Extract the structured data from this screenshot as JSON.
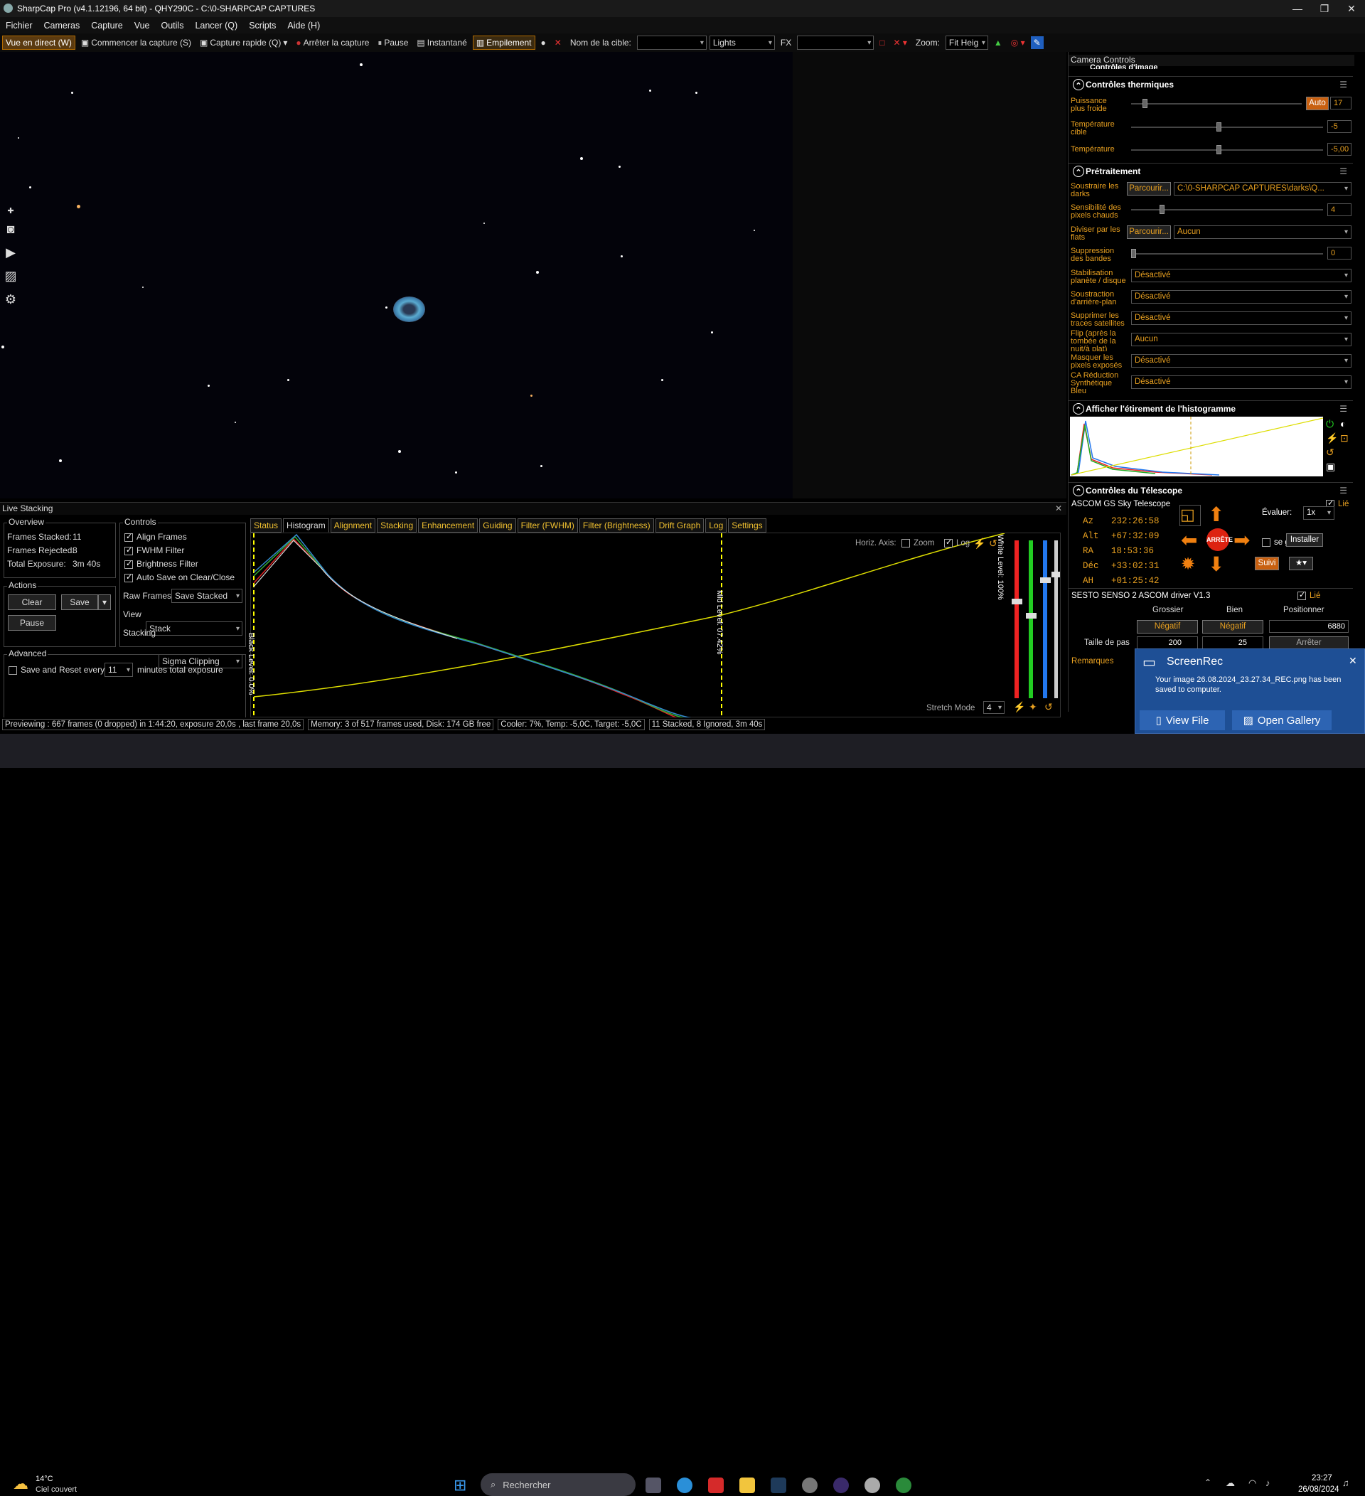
{
  "window": {
    "title": "SharpCap Pro (v4.1.12196, 64 bit) - QHY290C - C:\\0-SHARPCAP CAPTURES"
  },
  "menu": [
    "Fichier",
    "Cameras",
    "Capture",
    "Vue",
    "Outils",
    "Lancer (Q)",
    "Scripts",
    "Aide (H)"
  ],
  "toolbar": {
    "live_view": "Vue en direct (W)",
    "start_capture": "Commencer la capture (S)",
    "quick_capture": "Capture rapide (Q)",
    "stop_capture": "Arrêter la capture",
    "pause": "Pause",
    "snapshot": "Instantané",
    "stacking": "Empilement",
    "target_label": "Nom de la cible:",
    "target_value": "",
    "frame_type": "Lights",
    "fx_label": "FX",
    "fx_value": "",
    "zoom_label": "Zoom:",
    "zoom_value": "Fit Heig"
  },
  "live_stacking": {
    "title": "Live Stacking",
    "overview": {
      "label": "Overview",
      "frames_stacked_label": "Frames Stacked:",
      "frames_stacked": "11",
      "frames_rejected_label": "Frames Rejected:",
      "frames_rejected": "8",
      "total_exposure_label": "Total Exposure:",
      "total_exposure": "3m 40s"
    },
    "actions": {
      "label": "Actions",
      "clear": "Clear",
      "save": "Save",
      "pause": "Pause"
    },
    "controls": {
      "label": "Controls",
      "align": "Align Frames",
      "fwhm": "FWHM Filter",
      "brightness": "Brightness Filter",
      "autosave": "Auto Save on Clear/Close",
      "raw_frames_label": "Raw Frames",
      "raw_frames": "Save Stacked",
      "view_label": "View",
      "view": "Stack",
      "stacking_label": "Stacking",
      "stacking": "Sigma Clipping"
    },
    "advanced": {
      "label": "Advanced",
      "save_reset": "Save and Reset every",
      "minutes": "11",
      "suffix": "minutes total exposure"
    },
    "tabs": [
      "Status",
      "Histogram",
      "Alignment",
      "Stacking",
      "Enhancement",
      "Guiding",
      "Filter (FWHM)",
      "Filter (Brightness)",
      "Drift Graph",
      "Log",
      "Settings"
    ],
    "histogram": {
      "horiz_axis": "Horiz. Axis:",
      "zoom": "Zoom",
      "log": "Log",
      "black_level": "Black Level: 0.0%",
      "mid_level": "Mid Level: 07.42%",
      "white_level": "White Level: 100%",
      "stretch_mode": "Stretch Mode",
      "stretch_value": "4"
    }
  },
  "status_bar": [
    "Previewing : 667 frames (0 dropped) in 1:44:20, exposure 20,0s , last frame 20,0s",
    "Memory: 3 of 517 frames used, Disk: 174 GB free",
    "Cooler: 7%, Temp: -5,0C, Target: -5,0C",
    "11 Stacked, 8 Ignored, 3m 40s"
  ],
  "camera_controls": {
    "title": "Camera Controls",
    "image_controls": "Contrôles d'image",
    "thermal": {
      "title": "Contrôles thermiques",
      "power_label": "Puissance plus froide",
      "power_auto": "Auto",
      "power_value": "17",
      "target_label": "Température cible",
      "target_value": "-5",
      "temp_label": "Température",
      "temp_value": "-5,00"
    },
    "preprocessing": {
      "title": "Prétraitement",
      "darks_label": "Soustraire les darks",
      "browse": "Parcourir...",
      "darks_path": "C:\\0-SHARPCAP CAPTURES\\darks\\Q...",
      "hot_pixels_label": "Sensibilité des pixels chauds",
      "hot_pixels_value": "4",
      "flats_label": "Diviser par les flats",
      "flats_value": "Aucun",
      "banding_label": "Suppression des bandes",
      "banding_value": "0",
      "stabilization_label": "Stabilisation planète / disque",
      "stabilization_value": "Désactivé",
      "bg_sub_label": "Soustraction d'arrière-plan",
      "bg_sub_value": "Désactivé",
      "satellite_label": "Supprimer les traces satellites",
      "satellite_value": "Désactivé",
      "flip_label": "Flip (après la tombée de la nuit/à plat)",
      "flip_value": "Aucun",
      "mask_label": "Masquer les pixels exposés",
      "mask_value": "Désactivé",
      "ca_label": "CA Réduction Synthétique Bleu",
      "ca_value": "Désactivé"
    },
    "histogram_stretch": {
      "title": "Afficher l'étirement de l'histogramme"
    },
    "telescope": {
      "title": "Contrôles du Télescope",
      "driver": "ASCOM GS Sky Telescope",
      "linked": "Lié",
      "az_label": "Az",
      "az": "232:26:58",
      "alt_label": "Alt",
      "alt": "+67:32:09",
      "ra_label": "RA",
      "ra": "18:53:36",
      "dec_label": "Déc",
      "dec": "+33:02:31",
      "ah_label": "AH",
      "ah": "+01:25:42",
      "rate_label": "Évaluer:",
      "rate": "1x",
      "stop": "ARRÊTE",
      "park": "se garer",
      "track": "Suivi"
    },
    "focuser": {
      "driver": "SESTO SENSO 2 ASCOM driver V1.3",
      "linked": "Lié",
      "coarse": "Grossier",
      "fine": "Bien",
      "position": "Positionner",
      "negative": "Négatif",
      "position_value": "6880",
      "step_label": "Taille de pas",
      "step_coarse": "200",
      "step_fine": "25",
      "install": "Installer",
      "stop": "Arrêter",
      "notes": "Remarques"
    }
  },
  "toast": {
    "app": "ScreenRec",
    "message": "Your image 26.08.2024_23.27.34_REC.png has been saved to computer.",
    "view_file": "View File",
    "open_gallery": "Open Gallery"
  },
  "taskbar": {
    "weather_temp": "14°C",
    "weather_desc": "Ciel couvert",
    "search": "Rechercher",
    "time": "23:27",
    "date": "26/08/2024"
  },
  "colors": {
    "accent": "#e8a020",
    "toast": "#1e4f95"
  }
}
